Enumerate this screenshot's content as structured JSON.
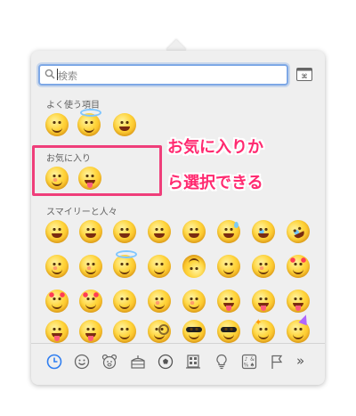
{
  "search": {
    "placeholder": "検索"
  },
  "sections": {
    "frequently_used": "よく使う項目",
    "favorites": "お気に入り",
    "smileys": "スマイリーと人々"
  },
  "annotation": {
    "line1": "お気に入りか",
    "line2": "ら選択できる",
    "color": "#ff2a70"
  },
  "category_bar": {
    "more_label": "»",
    "icons": [
      "clock-icon",
      "smiley-icon",
      "bear-icon",
      "food-icon",
      "soccer-ball-icon",
      "building-icon",
      "lightbulb-icon",
      "symbols-icon",
      "flag-icon"
    ]
  },
  "colors": {
    "panel": "#efefef",
    "search_focus": "#7ea8e6",
    "highlight": "#ef3e7a"
  }
}
